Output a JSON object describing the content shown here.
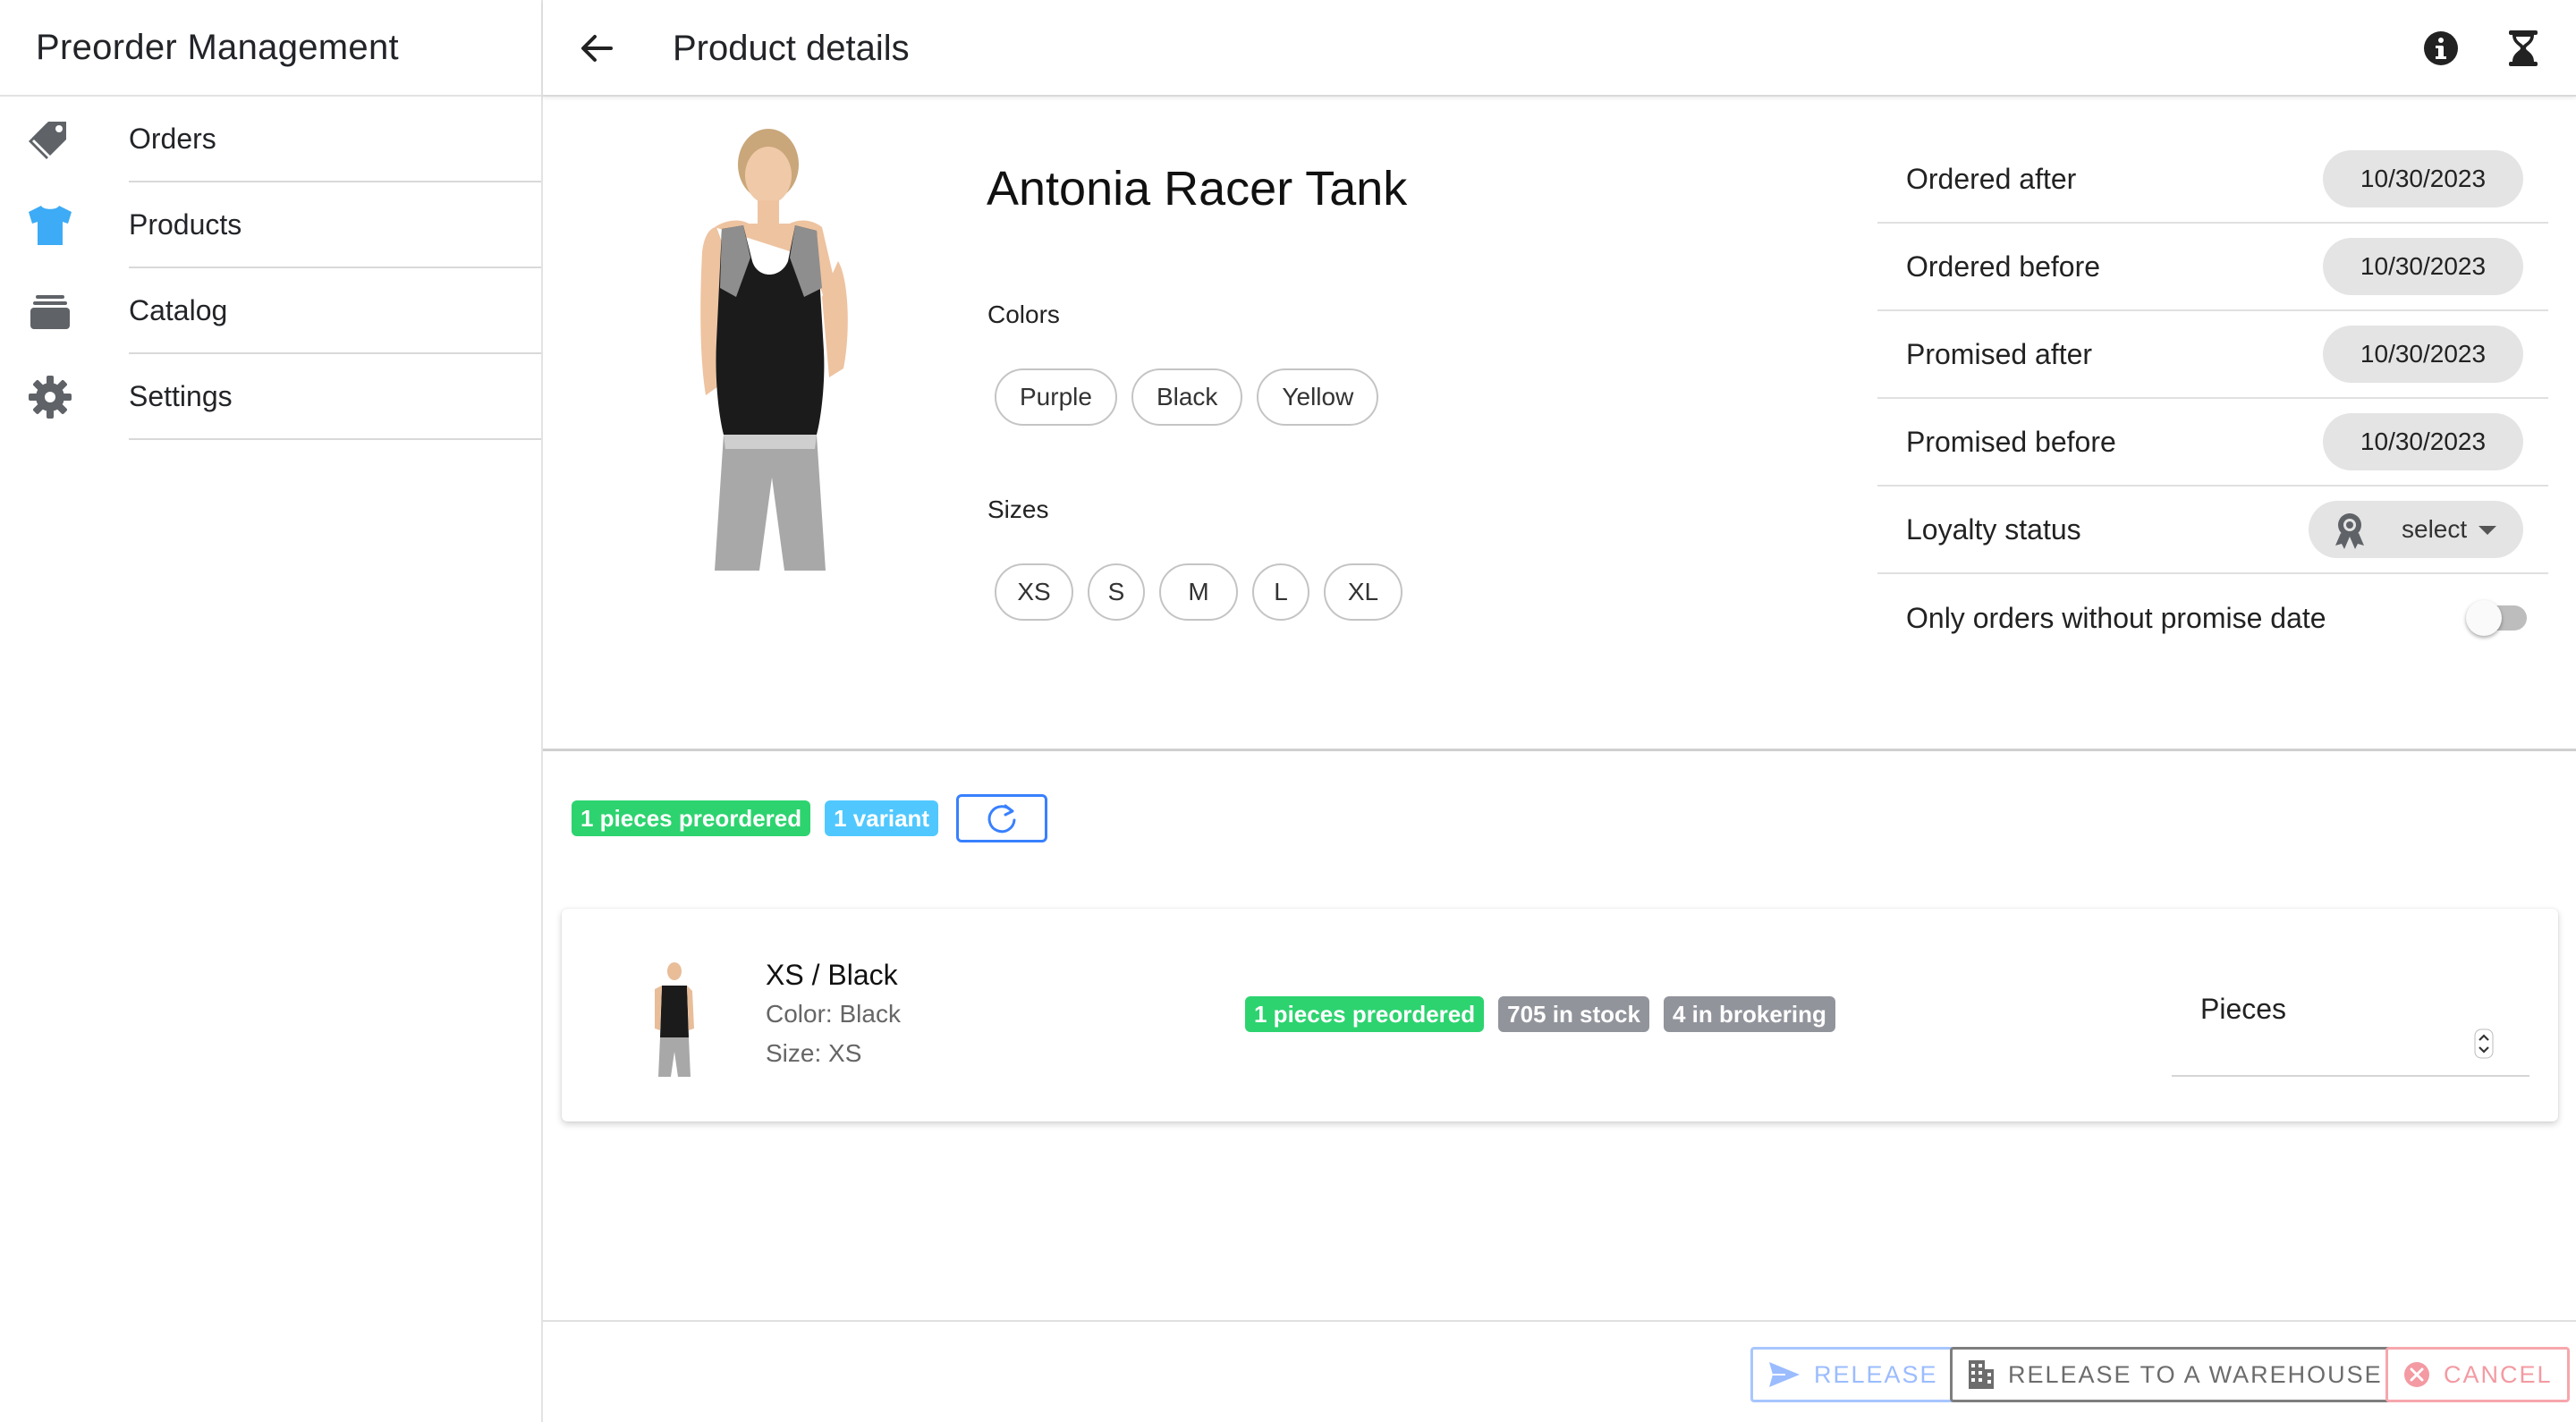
{
  "app": {
    "title": "Preorder Management"
  },
  "sidebar": {
    "items": [
      {
        "label": "Orders",
        "icon": "pricetags-icon",
        "active": false
      },
      {
        "label": "Products",
        "icon": "shirt-icon",
        "active": true
      },
      {
        "label": "Catalog",
        "icon": "albums-icon",
        "active": false
      },
      {
        "label": "Settings",
        "icon": "settings-icon",
        "active": false
      }
    ]
  },
  "header": {
    "title": "Product details"
  },
  "product": {
    "name": "Antonia Racer Tank",
    "colors_label": "Colors",
    "colors": [
      "Purple",
      "Black",
      "Yellow"
    ],
    "sizes_label": "Sizes",
    "sizes": [
      "XS",
      "S",
      "M",
      "L",
      "XL"
    ]
  },
  "filters": {
    "ordered_after": {
      "label": "Ordered after",
      "value": "10/30/2023"
    },
    "ordered_before": {
      "label": "Ordered before",
      "value": "10/30/2023"
    },
    "promised_after": {
      "label": "Promised after",
      "value": "10/30/2023"
    },
    "promised_before": {
      "label": "Promised before",
      "value": "10/30/2023"
    },
    "loyalty": {
      "label": "Loyalty status",
      "value": "select"
    },
    "no_promise": {
      "label": "Only orders without promise date",
      "checked": false
    }
  },
  "summary": {
    "preordered": "1 pieces preordered",
    "variants": "1 variant"
  },
  "variant": {
    "title": "XS / Black",
    "color": "Color: Black",
    "size": "Size: XS",
    "preordered": "1 pieces preordered",
    "stock": "705 in stock",
    "brokering": "4 in brokering",
    "pieces_label": "Pieces"
  },
  "footer": {
    "release": "RELEASE",
    "release_warehouse": "RELEASE TO A WAREHOUSE",
    "cancel": "CANCEL"
  },
  "colors": {
    "primary": "#3880ff",
    "success": "#2dd36f",
    "secondary": "#50c8ff",
    "medium": "#92949c",
    "danger": "#eb445a",
    "sidebar_active_icon": "#3dabf5"
  }
}
